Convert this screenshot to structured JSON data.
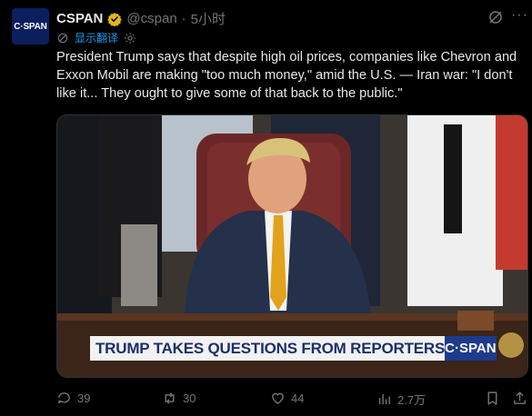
{
  "author": {
    "avatar_text": "C·SPAN",
    "display_name": "CSPAN",
    "handle": "@cspan",
    "separator": "·",
    "time": "5小时"
  },
  "translate": {
    "label": "显示翻译"
  },
  "tweet": {
    "text": "President Trump says that despite high oil prices, companies like Chevron and Exxon Mobil are making \"too much money,\" amid the U.S. — Iran war: \"I don't like it... They ought to give some of that back to the public.\""
  },
  "media": {
    "banner_text": "TRUMP TAKES QUESTIONS FROM REPORTERS",
    "banner_logo": "C·SPAN"
  },
  "actions": {
    "reply_count": "39",
    "repost_count": "30",
    "like_count": "44",
    "views_count": "2.7万"
  },
  "colors": {
    "background": "#000000",
    "accent": "#1d9bf0",
    "muted": "#71767b",
    "verified": "#e2b719",
    "cspan_blue": "#1e3a8a"
  }
}
